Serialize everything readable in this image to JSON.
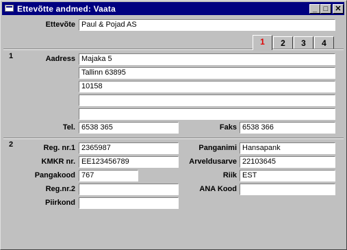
{
  "window": {
    "title": "Ettevõtte andmed: Vaata",
    "controls": {
      "minimize": "_",
      "maximize": "□",
      "close": "✕"
    }
  },
  "company": {
    "label": "Ettevõte",
    "value": "Paul & Pojad AS"
  },
  "tabs": [
    {
      "label": "1",
      "active": true
    },
    {
      "label": "2",
      "active": false
    },
    {
      "label": "3",
      "active": false
    },
    {
      "label": "4",
      "active": false
    }
  ],
  "section1": {
    "number": "1",
    "address_label": "Aadress",
    "address_lines": [
      "Majaka 5",
      "Tallinn 63895",
      "10158",
      "",
      ""
    ],
    "phone_label": "Tel.",
    "phone": "6538 365",
    "fax_label": "Faks",
    "fax": "6538 366"
  },
  "section2": {
    "number": "2",
    "reg1_label": "Reg. nr.1",
    "reg1": "2365987",
    "kmkr_label": "KMKR nr.",
    "kmkr": "EE123456789",
    "bankcode_label": "Pangakood",
    "bankcode": "767",
    "reg2_label": "Reg.nr.2",
    "reg2": "",
    "region_label": "Piirkond",
    "region": "",
    "bankname_label": "Panganimi",
    "bankname": "Hansapank",
    "account_label": "Arveldusarve",
    "account": "22103645",
    "country_label": "Riik",
    "country": "EST",
    "ana_label": "ANA Kood",
    "ana": ""
  }
}
